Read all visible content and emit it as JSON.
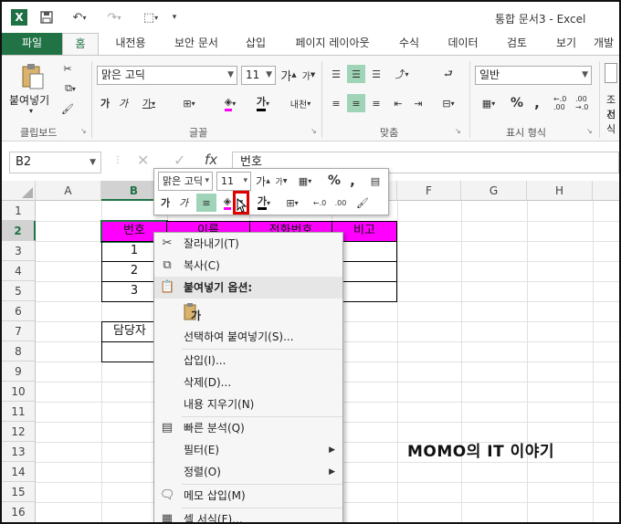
{
  "window": {
    "title": "통합 문서3 - Excel"
  },
  "tabs": [
    "파일",
    "홈",
    "내전용",
    "보안 문서",
    "삽입",
    "페이지 레이아웃",
    "수식",
    "데이터",
    "검토",
    "보기",
    "개발"
  ],
  "ribbon": {
    "clipboard": {
      "paste_label": "붙여넣기",
      "group_label": "클립보드"
    },
    "font": {
      "font_name": "맑은 고딕",
      "font_size": "11",
      "bold": "가",
      "italic": "가",
      "underline": "가",
      "increase": "가",
      "decrease": "가",
      "wrap": "내천",
      "font_color_glyph": "가",
      "group_label": "글꼴"
    },
    "align": {
      "group_label": "맞춤"
    },
    "number": {
      "format": "일반",
      "percent": "%",
      "comma": ",",
      "dec_inc": "←.0 .00",
      "dec_dec": ".00 →.0",
      "group_label": "표시 형식"
    },
    "styles": {
      "label_top": "조건",
      "label_bottom": "서식"
    }
  },
  "formula_bar": {
    "name_box": "B2",
    "fx": "fx",
    "value": "번호"
  },
  "columns": [
    "A",
    "B",
    "C",
    "D",
    "E",
    "F",
    "G",
    "H"
  ],
  "rows": [
    "1",
    "2",
    "3",
    "4",
    "5",
    "6",
    "7",
    "8",
    "9",
    "10",
    "11",
    "12",
    "13",
    "14",
    "15",
    "16"
  ],
  "cells": {
    "b2": "번호",
    "c2": "이름",
    "d2": "전화번호",
    "e2": "비고",
    "b3": "1",
    "b4": "2",
    "b5": "3",
    "b7": "담당자"
  },
  "colors": {
    "header_fill": "#ff00ff",
    "excel_green": "#217346",
    "highlight": "#9fd4b8",
    "callout": "#e00000"
  },
  "mini_toolbar": {
    "font_name": "맑은 고딕",
    "font_size": "11",
    "bold": "가",
    "italic": "가",
    "percent": "%",
    "comma": ",",
    "font_color_glyph": "가",
    "dec_inc": "←.0",
    "dec_dec": ".00"
  },
  "context_menu": {
    "items": [
      {
        "label": "잘라내기(T)",
        "icon": "scissors-icon"
      },
      {
        "label": "복사(C)",
        "icon": "copy-icon"
      },
      {
        "label": "붙여넣기 옵션:",
        "icon": "paste-icon"
      },
      {
        "label": "가",
        "icon": "paste-option-icon"
      },
      {
        "label": "선택하여 붙여넣기(S)...",
        "icon": ""
      },
      {
        "label": "삽입(I)...",
        "icon": ""
      },
      {
        "label": "삭제(D)...",
        "icon": ""
      },
      {
        "label": "내용 지우기(N)",
        "icon": ""
      },
      {
        "label": "빠른 분석(Q)",
        "icon": "quick-analysis-icon"
      },
      {
        "label": "필터(E)",
        "icon": ""
      },
      {
        "label": "정렬(O)",
        "icon": ""
      },
      {
        "label": "메모 삽입(M)",
        "icon": "comment-icon"
      },
      {
        "label": "셀 서식(F)...",
        "icon": "format-cells-icon"
      }
    ]
  },
  "watermark": "MOMO의 IT 이야기"
}
